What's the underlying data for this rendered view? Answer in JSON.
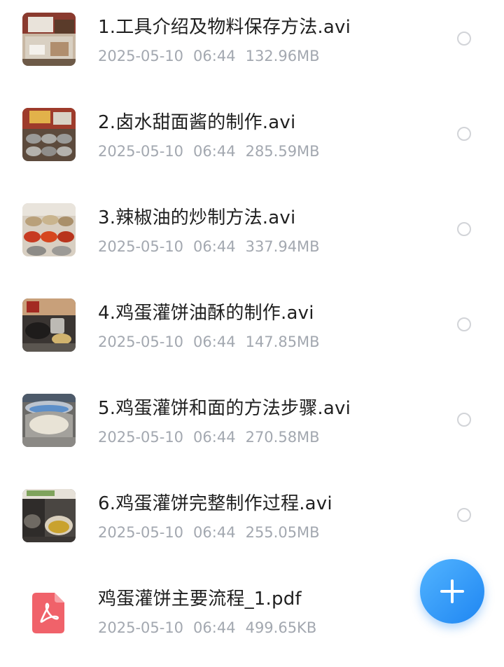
{
  "files": [
    {
      "name": "1.工具介绍及物料保存方法.avi",
      "date": "2025-05-10",
      "time": "06:44",
      "size": "132.96MB",
      "type": "video",
      "thumbnail": "video-thumbnail-tools"
    },
    {
      "name": "2.卤水甜面酱的制作.avi",
      "date": "2025-05-10",
      "time": "06:44",
      "size": "285.59MB",
      "type": "video",
      "thumbnail": "video-thumbnail-sauce-pans"
    },
    {
      "name": "3.辣椒油的炒制方法.avi",
      "date": "2025-05-10",
      "time": "06:44",
      "size": "337.94MB",
      "type": "video",
      "thumbnail": "video-thumbnail-chili-oil"
    },
    {
      "name": "4.鸡蛋灌饼油酥的制作.avi",
      "date": "2025-05-10",
      "time": "06:44",
      "size": "147.85MB",
      "type": "video",
      "thumbnail": "video-thumbnail-stove"
    },
    {
      "name": "5.鸡蛋灌饼和面的方法步骤.avi",
      "date": "2025-05-10",
      "time": "06:44",
      "size": "270.58MB",
      "type": "video",
      "thumbnail": "video-thumbnail-flour-bowl"
    },
    {
      "name": "6.鸡蛋灌饼完整制作过程.avi",
      "date": "2025-05-10",
      "time": "06:44",
      "size": "255.05MB",
      "type": "video",
      "thumbnail": "video-thumbnail-oil-bowl"
    },
    {
      "name": "鸡蛋灌饼主要流程_1.pdf",
      "date": "2025-05-10",
      "time": "06:44",
      "size": "499.65KB",
      "type": "pdf",
      "thumbnail": "pdf-icon"
    }
  ],
  "fab": {
    "icon": "plus-icon"
  },
  "colors": {
    "title": "#1f1f1f",
    "meta": "#a3a8b0",
    "radio_border": "#d2d4d8",
    "pdf_red": "#f0626a",
    "fab_blue": "#1f86f2"
  }
}
